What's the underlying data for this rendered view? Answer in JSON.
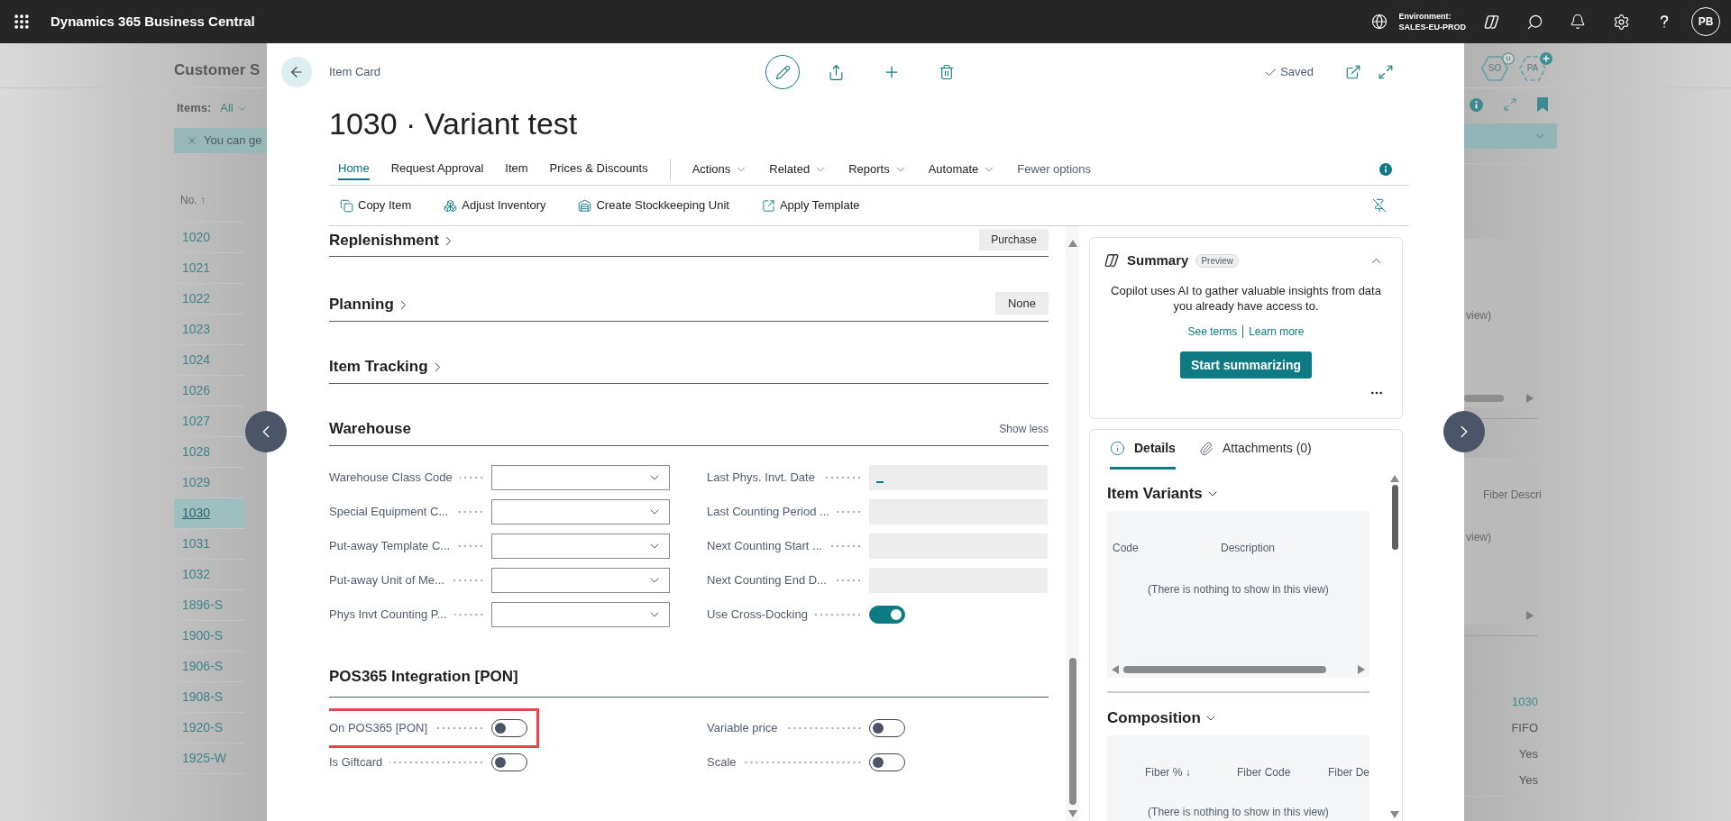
{
  "app_bar": {
    "title": "Dynamics 365 Business Central",
    "environment_label": "Environment:",
    "environment": "SALES-EU-PROD",
    "avatar": "PB"
  },
  "background": {
    "title": "Customer S",
    "filter_label": "Items:",
    "filter_value": "All",
    "banner": "You can ge",
    "list_column": "No. ↑",
    "rows": [
      {
        "text": "1020",
        "selected": false
      },
      {
        "text": "1021",
        "selected": false
      },
      {
        "text": "1022",
        "selected": false
      },
      {
        "text": "1023",
        "selected": false
      },
      {
        "text": "1024",
        "selected": false
      },
      {
        "text": "1026",
        "selected": false
      },
      {
        "text": "1027",
        "selected": false
      },
      {
        "text": "1028",
        "selected": false
      },
      {
        "text": "1029",
        "selected": false
      },
      {
        "text": "1030",
        "selected": true
      },
      {
        "text": "1031",
        "selected": false
      },
      {
        "text": "1032",
        "selected": false
      },
      {
        "text": "1896-S",
        "selected": false
      },
      {
        "text": "1900-S",
        "selected": false
      },
      {
        "text": "1906-S",
        "selected": false
      },
      {
        "text": "1908-S",
        "selected": false
      },
      {
        "text": "1920-S",
        "selected": false
      },
      {
        "text": "1925-W",
        "selected": false
      }
    ],
    "agents": [
      {
        "label": "SO",
        "kind": "paused"
      },
      {
        "label": "PA",
        "kind": "add"
      }
    ],
    "side_parts": [
      {
        "empty_text": "view)"
      },
      {
        "column": "Fiber Descri",
        "empty_text": "view)"
      }
    ],
    "side_values": [
      {
        "text": "1030",
        "kind": "link"
      },
      {
        "text": "FIFO",
        "kind": "text"
      },
      {
        "text": "Yes",
        "kind": "text"
      },
      {
        "text": "Yes",
        "kind": "text"
      }
    ]
  },
  "card": {
    "breadcrumb": "Item Card",
    "title": "1030 · Variant test",
    "status": "Saved",
    "tabs": [
      {
        "label": "Home",
        "selected": true
      },
      {
        "label": "Request Approval",
        "selected": false
      },
      {
        "label": "Item",
        "selected": false
      },
      {
        "label": "Prices & Discounts",
        "selected": false
      }
    ],
    "menus": [
      "Actions",
      "Related",
      "Reports",
      "Automate"
    ],
    "toggle_link": "Fewer options",
    "actions": [
      "Copy Item",
      "Adjust Inventory",
      "Create Stockkeeping Unit",
      "Apply Template"
    ],
    "sections": [
      {
        "title": "Replenishment",
        "expanded": false,
        "summary": "Purchase"
      },
      {
        "title": "Planning",
        "expanded": false,
        "summary": "None"
      },
      {
        "title": "Item Tracking",
        "expanded": false
      },
      {
        "title": "Warehouse",
        "expanded": true,
        "link": "Show less",
        "columns": [
          [
            {
              "label": "Warehouse Class Code",
              "kind": "dropdown"
            },
            {
              "label": "Special Equipment C...",
              "kind": "dropdown"
            },
            {
              "label": "Put-away Template C...",
              "kind": "dropdown"
            },
            {
              "label": "Put-away Unit of Me...",
              "kind": "dropdown"
            },
            {
              "label": "Phys Invt Counting P...",
              "kind": "dropdown"
            }
          ],
          [
            {
              "label": "Last Phys. Invt. Date",
              "kind": "text",
              "focused": true
            },
            {
              "label": "Last Counting Period ...",
              "kind": "text",
              "focused": false
            },
            {
              "label": "Next Counting Start ...",
              "kind": "text",
              "focused": false
            },
            {
              "label": "Next Counting End D...",
              "kind": "text",
              "focused": false
            },
            {
              "label": "Use Cross-Docking",
              "kind": "toggle",
              "on": true
            }
          ]
        ]
      },
      {
        "title": "POS365 Integration [PON]",
        "expanded": true,
        "columns": [
          [
            {
              "label": "On POS365 [PON]",
              "kind": "toggle",
              "on": false,
              "highlighted": true
            },
            {
              "label": "Is Giftcard",
              "kind": "toggle",
              "on": false,
              "highlighted": false
            }
          ],
          [
            {
              "label": "Variable price",
              "kind": "toggle",
              "on": false,
              "highlighted": false
            },
            {
              "label": "Scale",
              "kind": "toggle",
              "on": false,
              "highlighted": false
            }
          ]
        ]
      }
    ]
  },
  "factbox": {
    "summary": {
      "title": "Summary",
      "badge": "Preview",
      "expanded": true,
      "text": "Copilot uses AI to gather valuable insights from data you already have access to.",
      "links": [
        "See terms",
        "Learn more"
      ],
      "button": "Start summarizing"
    },
    "tabs": [
      {
        "label": "Details",
        "selected": true
      },
      {
        "label": "Attachments (0)",
        "selected": false
      }
    ],
    "parts": [
      {
        "title": "Item Variants",
        "columns": [
          "Code",
          "Description"
        ],
        "empty_text": "(There is nothing to show in this view)"
      },
      {
        "title": "Composition",
        "columns": [
          "Fiber % ↓",
          "Fiber Code",
          "Fiber De"
        ],
        "empty_text": "(There is nothing to show in this view)"
      }
    ]
  }
}
